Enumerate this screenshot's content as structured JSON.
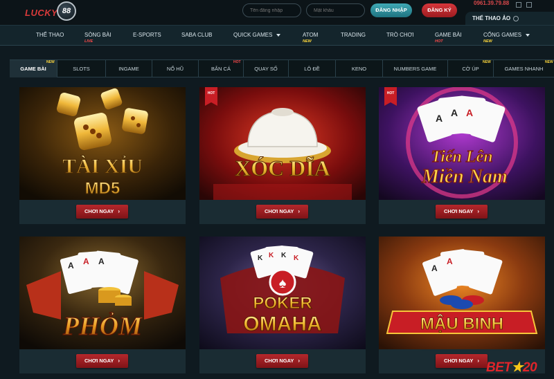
{
  "header": {
    "logo_text": "LUCKY",
    "logo_number": "88",
    "username_placeholder": "Tên đăng nhập",
    "password_placeholder": "Mật khẩu",
    "login_label": "ĐĂNG NHẬP",
    "register_label": "ĐĂNG KÝ",
    "phone": "0961.39.79.88",
    "fake_tab_label": "THỂ THAO ẢO"
  },
  "nav": [
    {
      "label": "THỂ THAO",
      "tag": ""
    },
    {
      "label": "SÒNG BÀI",
      "tag": "LIVE"
    },
    {
      "label": "E-SPORTS",
      "tag": ""
    },
    {
      "label": "SABA CLUB",
      "tag": ""
    },
    {
      "label": "QUICK GAMES",
      "tag": ""
    },
    {
      "label": "ATOM",
      "tag": "NEW"
    },
    {
      "label": "TRADING",
      "tag": ""
    },
    {
      "label": "TRÒ CHƠI",
      "tag": ""
    },
    {
      "label": "GAME BÀI",
      "tag": "HOT"
    },
    {
      "label": "CỔNG GAMES",
      "tag": "NEW"
    }
  ],
  "subtabs": [
    {
      "label": "GAME BÀI",
      "sup": "NEW"
    },
    {
      "label": "SLOTS",
      "sup": ""
    },
    {
      "label": "INGAME",
      "sup": ""
    },
    {
      "label": "NỔ HŨ",
      "sup": ""
    },
    {
      "label": "BẮN CÁ",
      "sup": "HOT"
    },
    {
      "label": "QUAY SỐ",
      "sup": ""
    },
    {
      "label": "LÔ ĐỀ",
      "sup": ""
    },
    {
      "label": "KENO",
      "sup": ""
    },
    {
      "label": "NUMBERS GAME",
      "sup": ""
    },
    {
      "label": "CỜ ÚP",
      "sup": "NEW"
    },
    {
      "label": "GAMES NHANH",
      "sup": "NEW"
    }
  ],
  "games": [
    {
      "title_line1": "TÀI XỈU",
      "title_line2": "MD5",
      "hot": false,
      "hot_label": ""
    },
    {
      "title_line1": "XÓC DĨA",
      "title_line2": "",
      "hot": true,
      "hot_label": "HOT"
    },
    {
      "title_line1": "Tiến Lên",
      "title_line2": "Miền Nam",
      "hot": true,
      "hot_label": "HOT"
    },
    {
      "title_line1": "PHỎM",
      "title_line2": "",
      "hot": false,
      "hot_label": ""
    },
    {
      "title_line1": "POKER",
      "title_line2": "OMAHA",
      "hot": false,
      "hot_label": ""
    },
    {
      "title_line1": "MẬU BINH",
      "title_line2": "",
      "hot": false,
      "hot_label": ""
    }
  ],
  "play_label": "CHƠI NGAY",
  "watermark": {
    "part1": "BET",
    "star": "★",
    "part2": "20"
  },
  "colors": {
    "accent": "#3fa9b5",
    "play": "#b5282c",
    "hot": "#c81e25",
    "new": "#ffd83c"
  }
}
